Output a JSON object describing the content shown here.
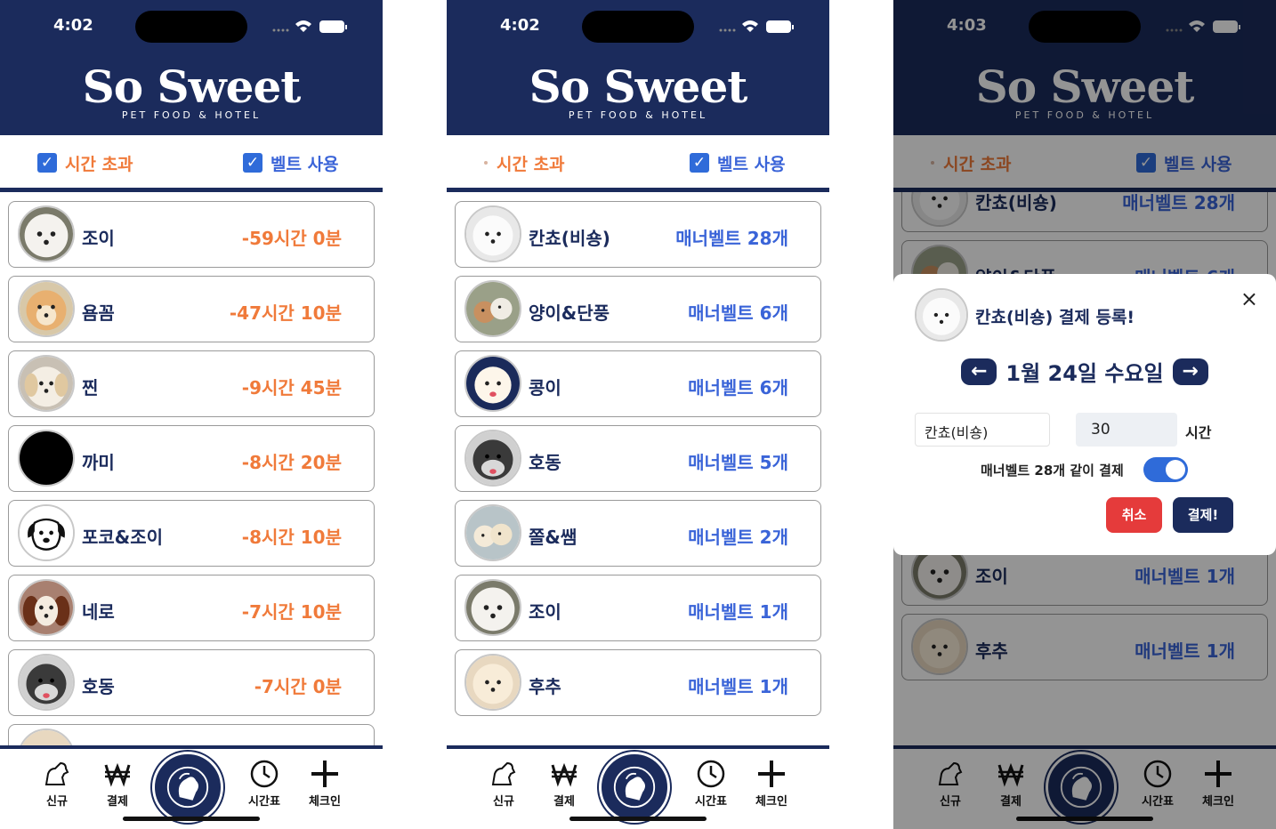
{
  "app": {
    "brand": "So Sweet",
    "subtitle": "PET FOOD & HOTEL",
    "filter_over": "시간 초과",
    "filter_belt": "벨트 사용"
  },
  "tabs": {
    "new": "신규",
    "pay": "결제",
    "schedule": "시간표",
    "checkin": "체크인"
  },
  "screen1": {
    "time": "4:02",
    "filter_over_checked": true,
    "filter_belt_checked": true,
    "items": [
      {
        "name": "조이",
        "value": "-59시간 0분"
      },
      {
        "name": "욤꼼",
        "value": "-47시간 10분"
      },
      {
        "name": "찐",
        "value": "-9시간 45분"
      },
      {
        "name": "까미",
        "value": "-8시간 20분"
      },
      {
        "name": "포코&조이",
        "value": "-8시간 10분"
      },
      {
        "name": "네로",
        "value": "-7시간 10분"
      },
      {
        "name": "호동",
        "value": "-7시간 0분"
      }
    ]
  },
  "screen2": {
    "time": "4:02",
    "filter_over_checked": false,
    "filter_belt_checked": true,
    "items": [
      {
        "name": "칸쵸(비숑)",
        "value": "매너벨트 28개"
      },
      {
        "name": "양이&단풍",
        "value": "매너벨트 6개"
      },
      {
        "name": "콩이",
        "value": "매너벨트 6개"
      },
      {
        "name": "호동",
        "value": "매너벨트 5개"
      },
      {
        "name": "쫄&쌤",
        "value": "매너벨트 2개"
      },
      {
        "name": "조이",
        "value": "매너벨트 1개"
      },
      {
        "name": "후추",
        "value": "매너벨트 1개"
      }
    ]
  },
  "screen3": {
    "time": "4:03",
    "items_top": [
      {
        "name": "칸쵸(비숑)",
        "value": "매너벨트 28개"
      },
      {
        "name": "양이&단풍",
        "value": "매너벨트 6개"
      }
    ],
    "items_bottom": [
      {
        "name": "조이",
        "value": "매너벨트 1개"
      },
      {
        "name": "후추",
        "value": "매너벨트 1개"
      }
    ],
    "modal": {
      "title": "칸쵸(비숑) 결제 등록!",
      "date": "1월 24일 수요일",
      "name_value": "칸쵸(비숑)",
      "hours_value": "30",
      "hours_unit": "시간",
      "toggle_label": "매너벨트 28개 같이 결제",
      "toggle_on": true,
      "cancel": "취소",
      "pay": "결제!",
      "close": "×",
      "prev": "←",
      "next": "→"
    }
  },
  "colors": {
    "navy": "#1b2b5c",
    "orange": "#f07a3a",
    "blue": "#3a64d8",
    "red": "#e53b3b"
  }
}
